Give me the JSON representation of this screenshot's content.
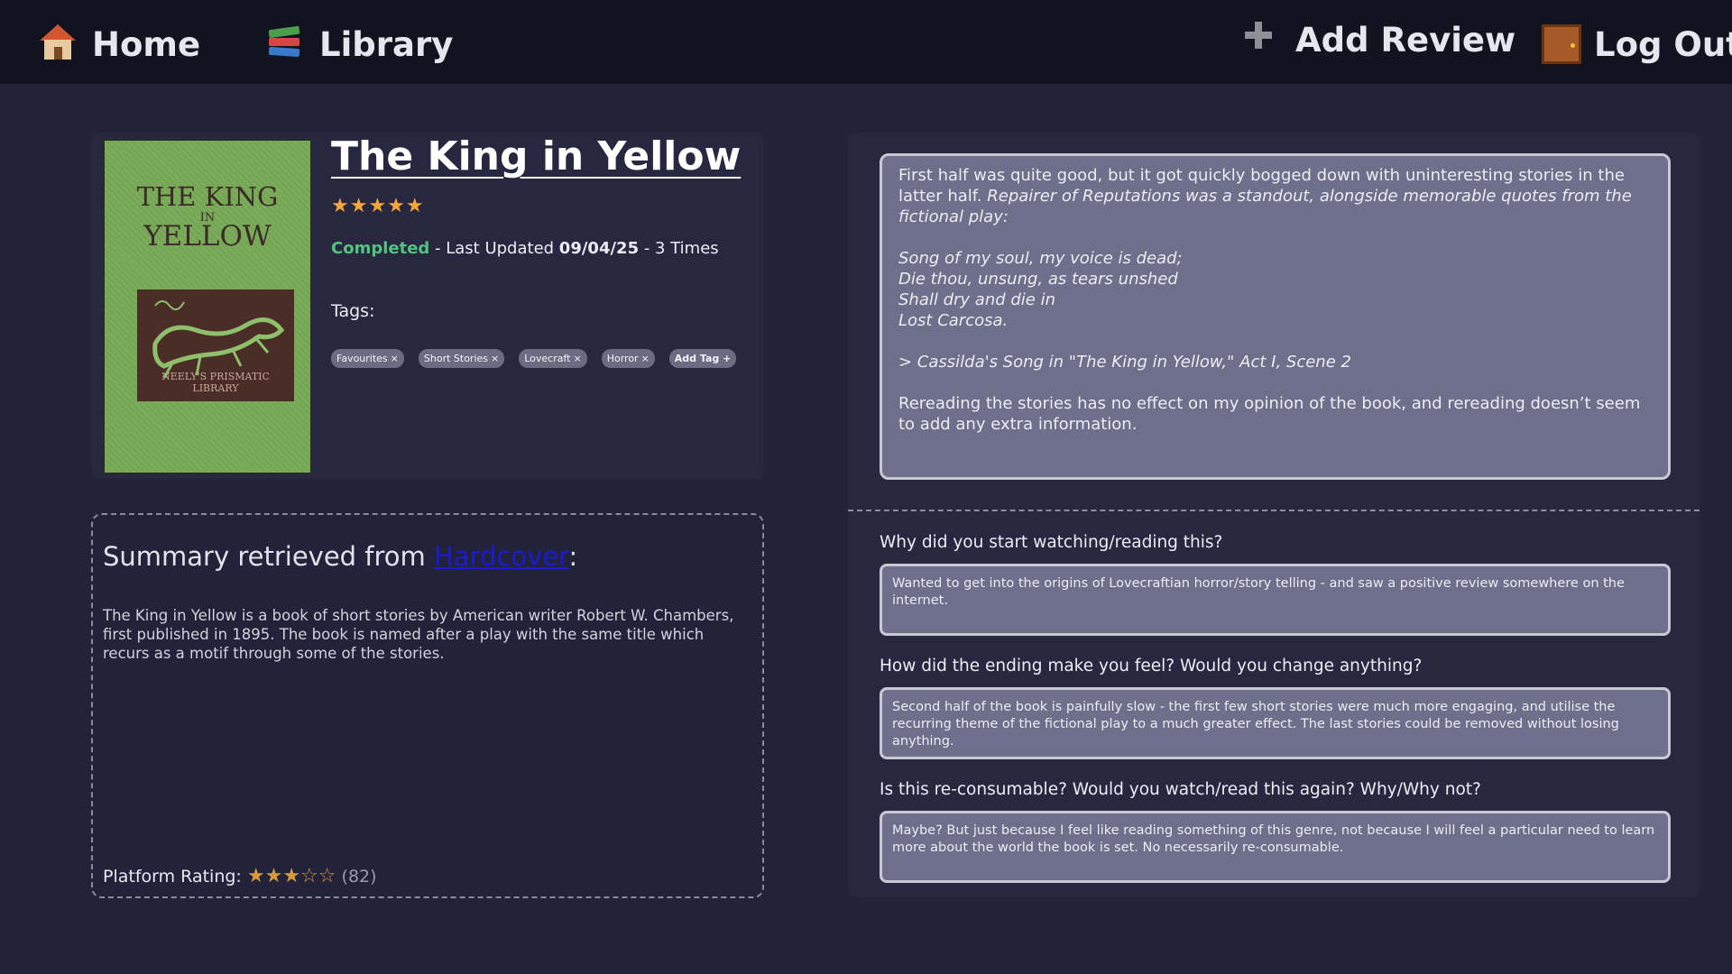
{
  "nav": {
    "home": "Home",
    "library": "Library",
    "add_review": "Add Review",
    "log_out": "Log Out"
  },
  "book": {
    "title": "The King in Yellow",
    "rating_stars": "★★★★★",
    "rating": 5,
    "status": "Completed",
    "last_updated_prefix": " - Last Updated ",
    "last_updated": "09/04/25",
    "times_sep": " - ",
    "times": "3 Times",
    "tags_label": "Tags:",
    "tags": [
      "Favourites",
      "Short Stories",
      "Lovecraft",
      "Horror"
    ],
    "add_tag": "Add Tag +",
    "cover": {
      "title_line1": "THE KING",
      "title_line2": "IN",
      "title_line3": "YELLOW",
      "caption": "NEELY'S PRISMATIC LIBRARY"
    }
  },
  "summary": {
    "heading_prefix": "Summary retrieved from ",
    "source_link": "Hardcover",
    "heading_suffix": ":",
    "text": "The King in Yellow is a book of short stories by American writer Robert W. Chambers, first published in 1895. The book is named after a play with the same title which recurs as a motif through some of the stories.",
    "platform_label": "Platform Rating:",
    "platform_stars": "★★★☆☆",
    "platform_rating": 3.5,
    "platform_count": "(82)"
  },
  "review": {
    "p1_plain": "First half was quite good, but it got quickly bogged down with uninteresting stories in the latter half. ",
    "p1_italic": "Repairer of Reputations was a standout, alongside memorable quotes from the fictional play:",
    "poem": [
      "Song of my soul, my voice is dead;",
      "Die thou, unsung, as tears unshed",
      "Shall dry and die in",
      "Lost Carcosa."
    ],
    "quote_source": "> Cassilda's Song in \"The King in Yellow,\" Act I, Scene 2",
    "p3": "Rereading the stories has no effect on my opinion of the book, and rereading doesn’t seem to add any extra information."
  },
  "questions": [
    {
      "label": "Why did you start watching/reading this?",
      "answer": "Wanted to get into the origins of Lovecraftian horror/story telling - and saw a positive review somewhere on the internet."
    },
    {
      "label": "How did the ending make you feel? Would you change anything?",
      "answer": "Second half of the book is painfully slow - the first few short stories were much more engaging, and utilise the recurring theme of the fictional play to a much greater effect. The last stories could be removed without losing anything."
    },
    {
      "label": "Is this re-consumable? Would you watch/read this again? Why/Why not?",
      "answer": "Maybe? But just because I feel like reading something of this genre, not because I will feel a particular need to learn more about the world the book is set. No necessarily re-consumable."
    }
  ],
  "colors": {
    "background": "#22223a",
    "nav": "#13131f",
    "card": "#272740",
    "accent_green": "#52c47e",
    "star": "#f2a63b",
    "link": "#1b1bd0"
  }
}
